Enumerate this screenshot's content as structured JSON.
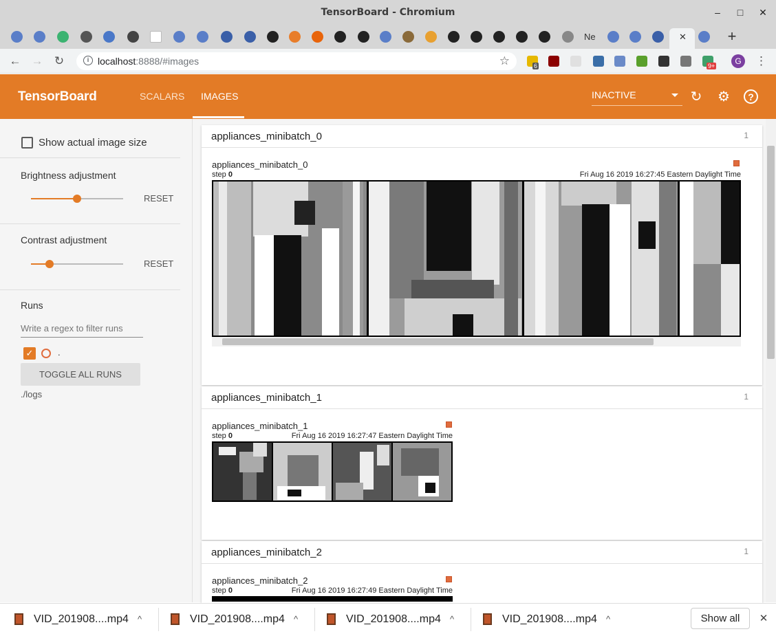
{
  "window": {
    "title": "TensorBoard - Chromium",
    "minimize": "–",
    "maximize": "□",
    "close": "✕"
  },
  "tabs": {
    "new_tab": "+",
    "close_active": "✕",
    "ne_tab": "Ne"
  },
  "browser": {
    "url_host": "localhost",
    "url_path": ":8888/#images",
    "ext_badge_1": "6",
    "ext_badge_2": "9+",
    "profile_letter": "G",
    "star": "☆",
    "menu": "⋮"
  },
  "header": {
    "brand": "TensorBoard",
    "tabs": [
      {
        "label": "SCALARS"
      },
      {
        "label": "IMAGES"
      }
    ],
    "run_status": "INACTIVE",
    "colors": {
      "accent": "#e37b26"
    }
  },
  "sidebar": {
    "show_actual_size": "Show actual image size",
    "brightness": {
      "label": "Brightness adjustment",
      "reset": "RESET",
      "value": 0.5
    },
    "contrast": {
      "label": "Contrast adjustment",
      "reset": "RESET",
      "value": 0.2
    },
    "runs": {
      "label": "Runs",
      "filter_placeholder": "Write a regex to filter runs",
      "run_name": ".",
      "toggle_all": "TOGGLE ALL RUNS",
      "logdir": "./logs"
    }
  },
  "cards": [
    {
      "title": "appliances_minibatch_0",
      "count": "1",
      "image_title": "appliances_minibatch_0",
      "step_label": "step",
      "step": "0",
      "wall_time": "Fri Aug 16 2019 16:27:45 Eastern Daylight Time"
    },
    {
      "title": "appliances_minibatch_1",
      "count": "1",
      "image_title": "appliances_minibatch_1",
      "step_label": "step",
      "step": "0",
      "wall_time": "Fri Aug 16 2019 16:27:47 Eastern Daylight Time"
    },
    {
      "title": "appliances_minibatch_2",
      "count": "1",
      "image_title": "appliances_minibatch_2",
      "step_label": "step",
      "step": "0",
      "wall_time": "Fri Aug 16 2019 16:27:49 Eastern Daylight Time"
    }
  ],
  "downloads": {
    "items": [
      {
        "name": "VID_201908....mp4"
      },
      {
        "name": "VID_201908....mp4"
      },
      {
        "name": "VID_201908....mp4"
      },
      {
        "name": "VID_201908....mp4"
      }
    ],
    "show_all": "Show all",
    "close": "✕",
    "chevron": "^"
  }
}
